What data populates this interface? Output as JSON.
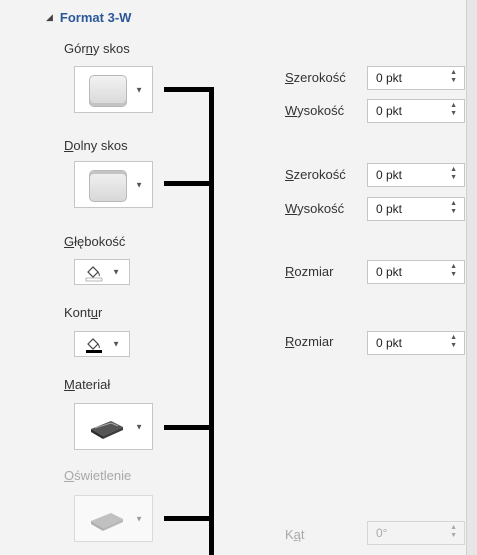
{
  "section": {
    "title": "Format 3-W"
  },
  "top_bevel": {
    "label_pre": "Gór",
    "label_u": "n",
    "label_post": "y skos",
    "width_label_u": "S",
    "width_label_rest": "zerokość",
    "width_value": "0 pkt",
    "height_label_u": "W",
    "height_label_rest": "ysokość",
    "height_value": "0 pkt"
  },
  "bottom_bevel": {
    "label_u": "D",
    "label_rest": "olny skos",
    "width_label_u": "S",
    "width_label_rest": "zerokość",
    "width_value": "0 pkt",
    "height_label_u": "W",
    "height_label_rest": "ysokość",
    "height_value": "0 pkt"
  },
  "depth": {
    "label_u": "G",
    "label_rest": "łębokość",
    "size_label_u": "R",
    "size_label_rest": "ozmiar",
    "size_value": "0 pkt",
    "color": "#ffffff"
  },
  "contour": {
    "label_pre": "Kont",
    "label_u": "u",
    "label_post": "r",
    "size_label_u": "R",
    "size_label_rest": "ozmiar",
    "size_value": "0 pkt",
    "color": "#000000"
  },
  "material": {
    "label_u": "M",
    "label_rest": "ateriał"
  },
  "lighting": {
    "label_u": "O",
    "label_rest": "świetlenie",
    "angle_label_pre": "K",
    "angle_label_u": "ą",
    "angle_label_post": "t",
    "angle_value": "0°"
  },
  "colors": {
    "accent": "#2b579a",
    "disabled_text": "#a8a8a8",
    "bracket": "#000000"
  }
}
